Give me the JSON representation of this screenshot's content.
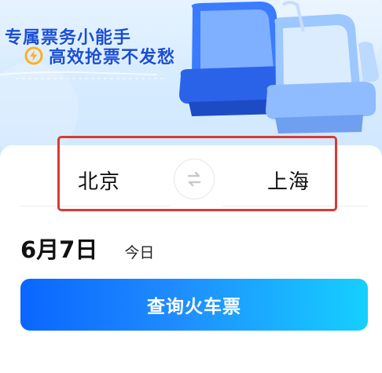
{
  "banner": {
    "title": "专属票务小能手",
    "subtitle": "高效抢票不发愁"
  },
  "route": {
    "from_city": "北京",
    "to_city": "上海"
  },
  "date": {
    "value": "6月7日",
    "day_label": "今日"
  },
  "search_button": {
    "label": "查询火车票"
  },
  "colors": {
    "highlight_border": "#d93a33",
    "brand_blue": "#1a4fd6",
    "button_start": "#0a66ff",
    "button_end": "#15d0ff"
  }
}
